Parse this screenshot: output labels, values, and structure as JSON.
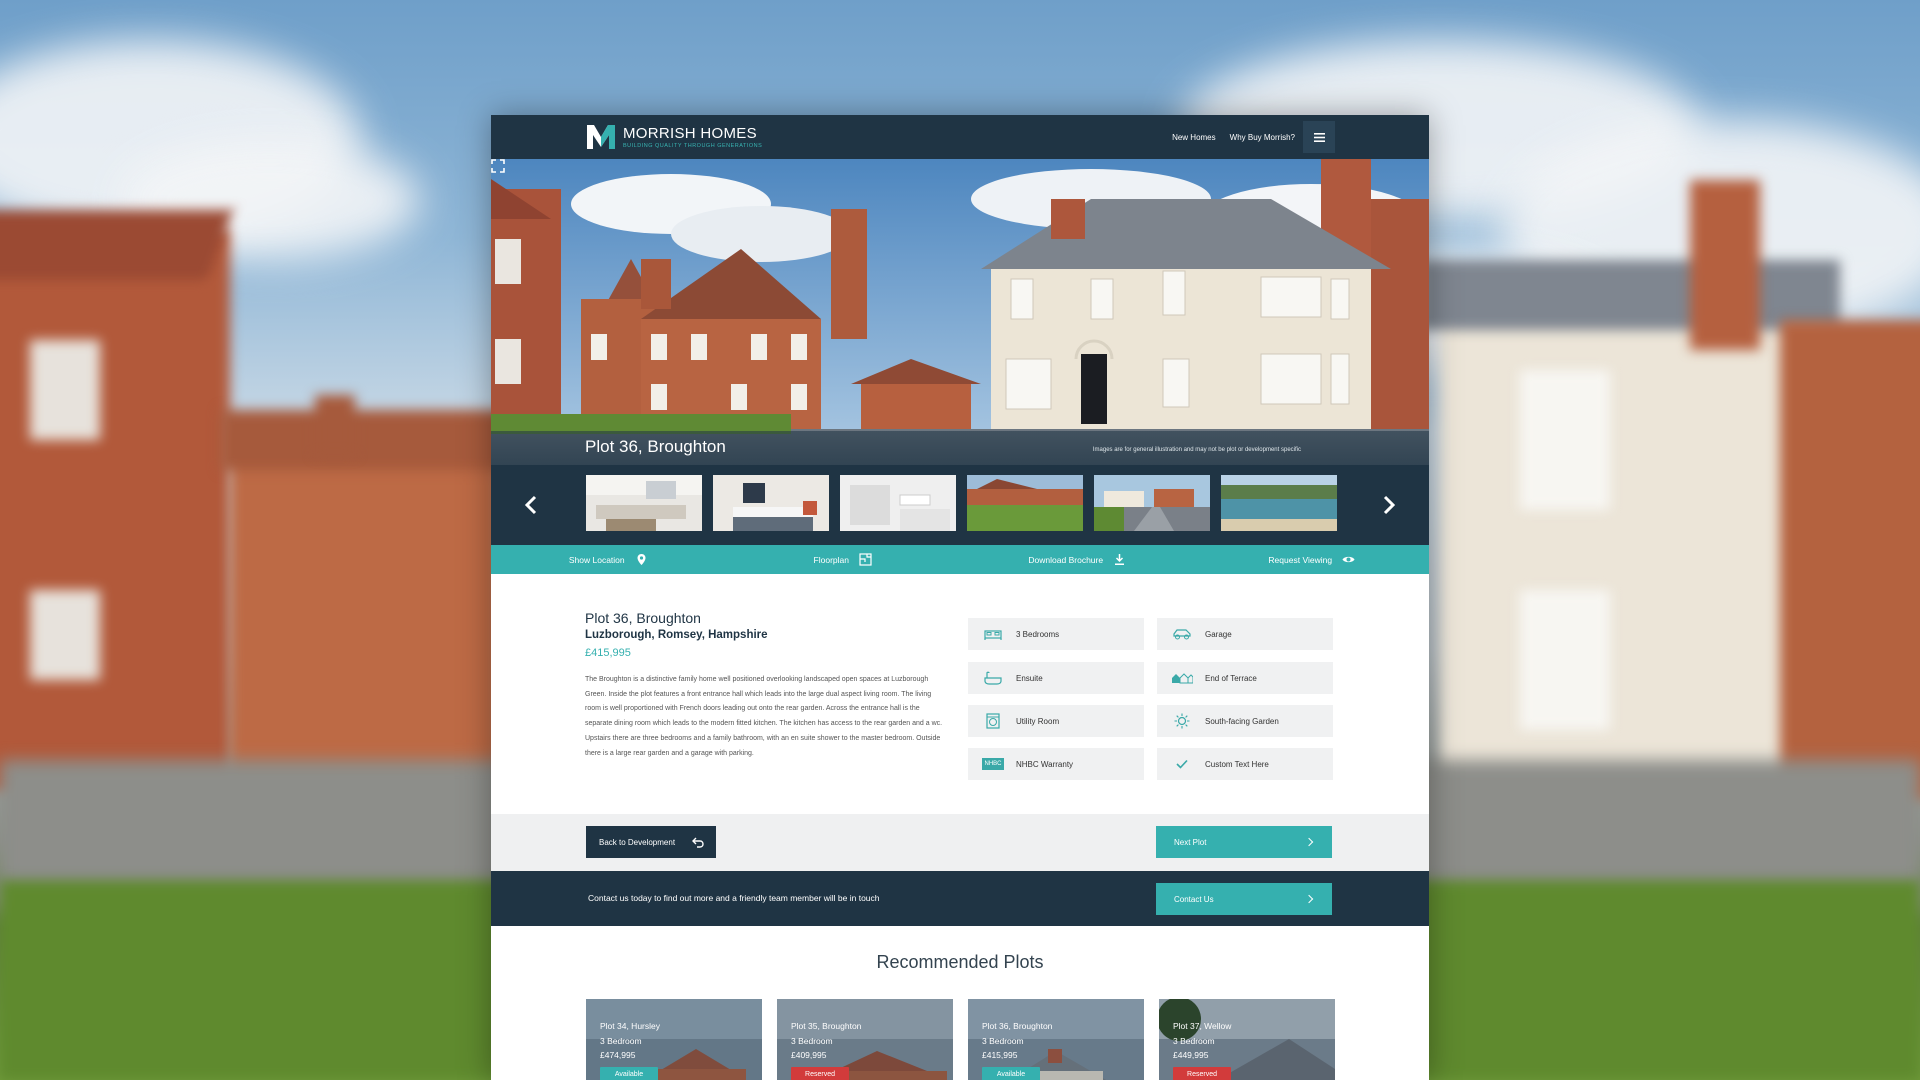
{
  "brand": {
    "name": "MORRISH HOMES",
    "tagline": "BUILDING QUALITY THROUGH GENERATIONS"
  },
  "nav": {
    "new_homes": "New Homes",
    "why_buy": "Why Buy Morrish?"
  },
  "hero": {
    "title": "Plot 36, Broughton",
    "disclaimer": "Images are for general illustration and may not be plot or development specific"
  },
  "gallery": {
    "thumbnails": [
      "kitchen-diner",
      "bedroom",
      "bathroom",
      "rear-garden",
      "street-view",
      "coastline"
    ]
  },
  "actions": [
    {
      "label": "Show Location",
      "icon": "map-pin-icon"
    },
    {
      "label": "Floorplan",
      "icon": "floorplan-icon"
    },
    {
      "label": "Download Brochure",
      "icon": "download-icon"
    },
    {
      "label": "Request Viewing",
      "icon": "eye-icon"
    }
  ],
  "plot": {
    "title": "Plot 36, Broughton",
    "location": "Luzborough, Romsey, Hampshire",
    "price": "£415,995",
    "description": "The Broughton is a distinctive family home well positioned overlooking landscaped open spaces at Luzborough Green. Inside the plot features a front entrance hall which leads into the large dual aspect living room. The living room is well proportioned with French doors leading out onto the rear garden. Across the entrance hall is the separate dining room which leads to the modern fitted kitchen. The kitchen has access to the rear garden and a wc. Upstairs there are three bedrooms and a family bathroom, with an en suite shower to the master bedroom. Outside there is a large rear garden and a garage with parking."
  },
  "features": [
    {
      "label": "3 Bedrooms",
      "icon": "bed-icon"
    },
    {
      "label": "Garage",
      "icon": "car-icon"
    },
    {
      "label": "Ensuite",
      "icon": "bath-icon"
    },
    {
      "label": "End of Terrace",
      "icon": "terrace-icon"
    },
    {
      "label": "Utility Room",
      "icon": "washing-machine-icon"
    },
    {
      "label": "South-facing Garden",
      "icon": "sun-icon"
    },
    {
      "label": "NHBC Warranty",
      "icon": "nhbc-icon",
      "badge_text": "NHBC"
    },
    {
      "label": "Custom Text Here",
      "icon": "check-icon"
    }
  ],
  "buttons": {
    "back": "Back to Development",
    "next": "Next Plot"
  },
  "contact": {
    "text": "Contact us today to find out more and a friendly team member will be in touch",
    "button": "Contact Us"
  },
  "recommended": {
    "title": "Recommended Plots",
    "cards": [
      {
        "name": "Plot 34, Hursley",
        "beds": "3 Bedroom",
        "price": "£474,995",
        "status": "Available",
        "status_color": "#35b0af"
      },
      {
        "name": "Plot 35, Broughton",
        "beds": "3 Bedroom",
        "price": "£409,995",
        "status": "Reserved",
        "status_color": "#d23b3b"
      },
      {
        "name": "Plot 36, Broughton",
        "beds": "3 Bedroom",
        "price": "£415,995",
        "status": "Available",
        "status_color": "#35b0af"
      },
      {
        "name": "Plot 37, Wellow",
        "beds": "3 Bedroom",
        "price": "£449,995",
        "status": "Reserved",
        "status_color": "#d23b3b"
      }
    ]
  },
  "colors": {
    "navy": "#1f3444",
    "teal": "#35b0af",
    "reserved": "#d23b3b"
  }
}
